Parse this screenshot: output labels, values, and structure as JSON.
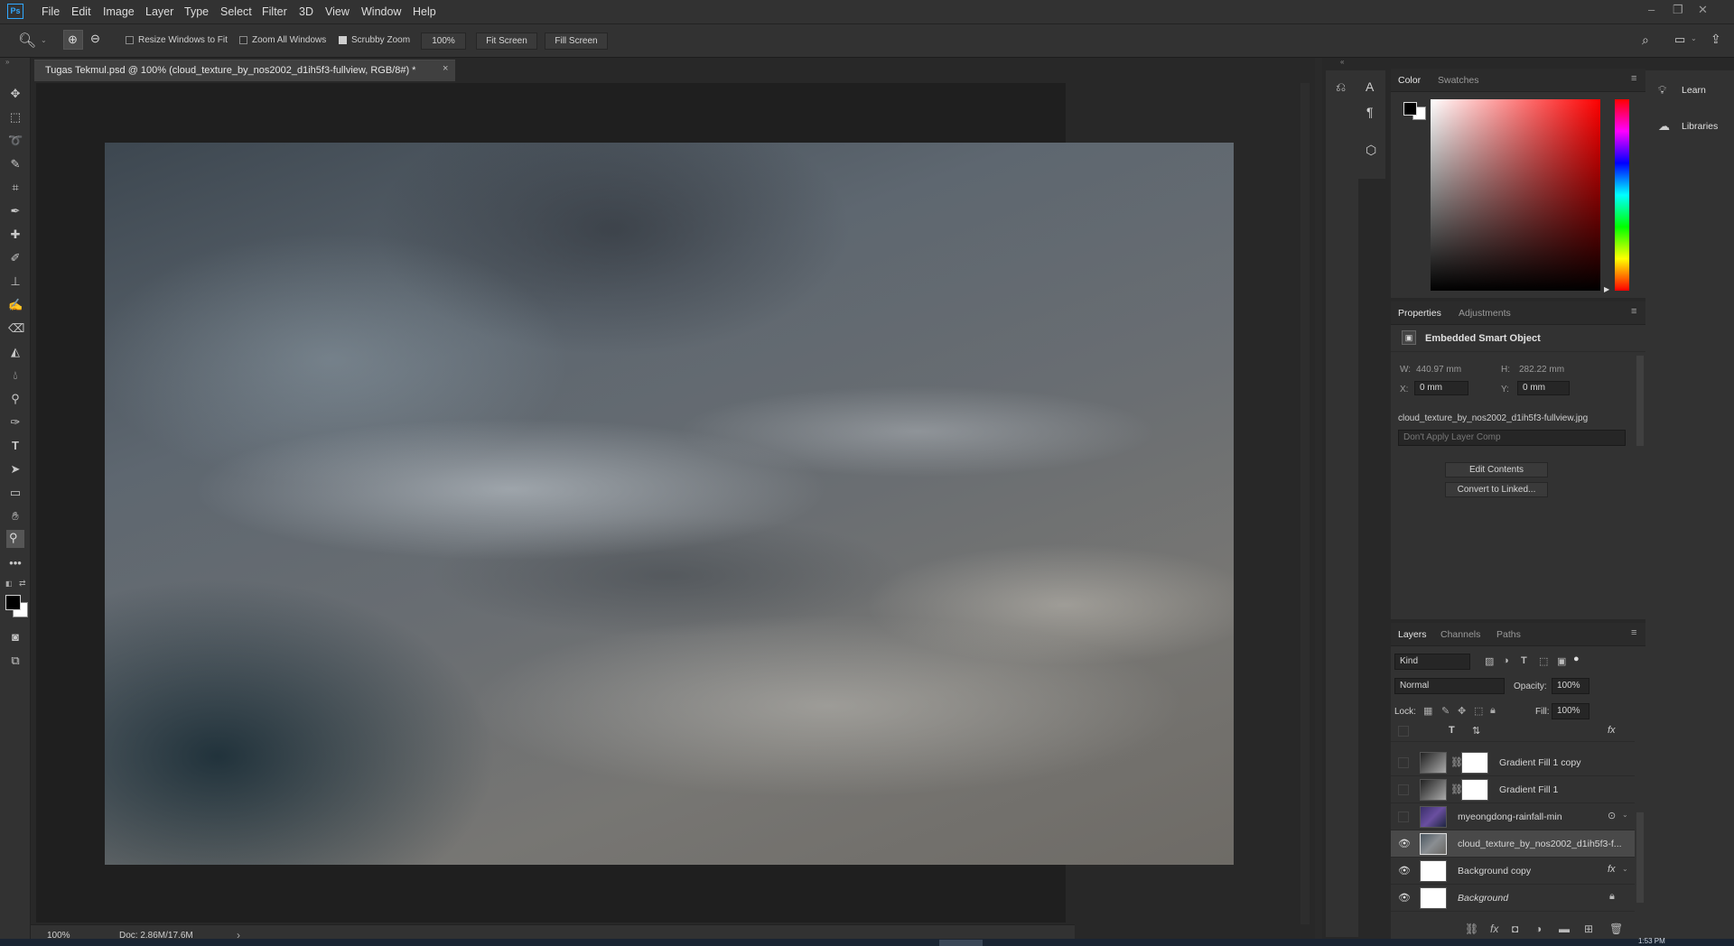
{
  "app": {
    "logo": "Ps"
  },
  "menu": [
    "File",
    "Edit",
    "Image",
    "Layer",
    "Type",
    "Select",
    "Filter",
    "3D",
    "View",
    "Window",
    "Help"
  ],
  "options": {
    "resize_windows": "Resize Windows to Fit",
    "zoom_all": "Zoom All Windows",
    "scrubby": "Scrubby Zoom",
    "zoom_value": "100%",
    "fit_screen": "Fit Screen",
    "fill_screen": "Fill Screen",
    "resize_checked": false,
    "zoom_all_checked": false,
    "scrubby_checked": true
  },
  "document": {
    "tab_title": "Tugas Tekmul.psd @ 100% (cloud_texture_by_nos2002_d1ih5f3-fullview, RGB/8#) *",
    "close": "×"
  },
  "status": {
    "zoom": "100%",
    "doc": "Doc: 2.86M/17.6M",
    "arrow": "›"
  },
  "color_panel": {
    "tab_color": "Color",
    "tab_swatches": "Swatches",
    "fg": "#000000",
    "bg": "#ffffff",
    "hue": "#ff0000"
  },
  "properties": {
    "tab_properties": "Properties",
    "tab_adjustments": "Adjustments",
    "type": "Embedded Smart Object",
    "w_label": "W:",
    "w_value": "440.97 mm",
    "h_label": "H:",
    "h_value": "282.22 mm",
    "x_label": "X:",
    "x_value": "0 mm",
    "y_label": "Y:",
    "y_value": "0 mm",
    "filename": "cloud_texture_by_nos2002_d1ih5f3-fullview.jpg",
    "layer_comp": "Don't Apply Layer Comp",
    "edit_contents": "Edit Contents",
    "convert_linked": "Convert to Linked..."
  },
  "layers_panel": {
    "tab_layers": "Layers",
    "tab_channels": "Channels",
    "tab_paths": "Paths",
    "kind": "Kind",
    "blend": "Normal",
    "opacity_label": "Opacity:",
    "opacity": "100%",
    "lock_label": "Lock:",
    "fill_label": "Fill:",
    "fill": "100%",
    "fx": "fx",
    "layers": [
      {
        "name": "Gradient Fill 1 copy",
        "visible": false
      },
      {
        "name": "Gradient Fill 1",
        "visible": false
      },
      {
        "name": "myeongdong-rainfall-min",
        "visible": false
      },
      {
        "name": "cloud_texture_by_nos2002_d1ih5f3-f...",
        "visible": true,
        "selected": true
      },
      {
        "name": "Background copy",
        "visible": true
      },
      {
        "name": "Background",
        "visible": true
      }
    ]
  },
  "right_panels": {
    "learn": "Learn",
    "libraries": "Libraries"
  },
  "taskbar": {
    "time": "1:53 PM"
  }
}
